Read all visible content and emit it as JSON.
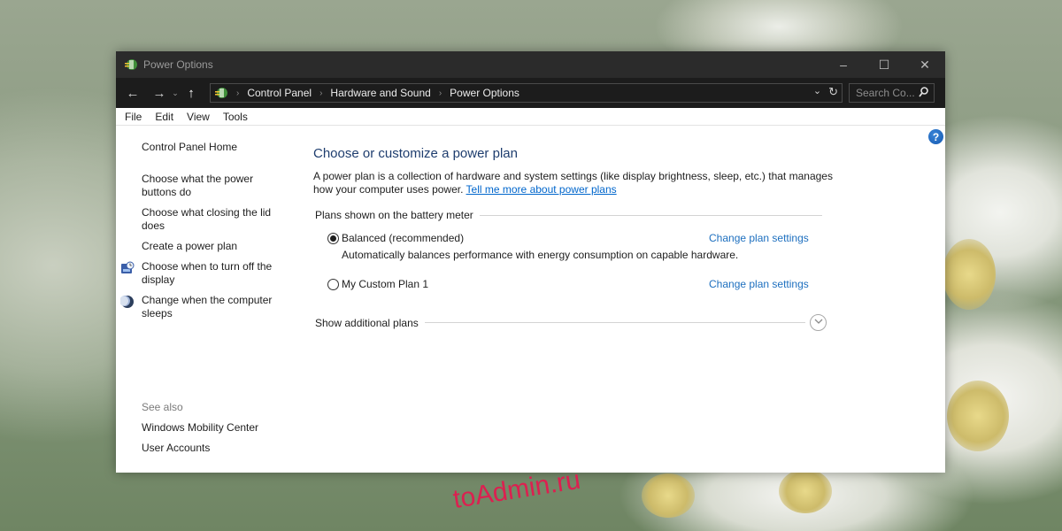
{
  "window": {
    "title": "Power Options",
    "controls": {
      "minimize": "–",
      "maximize": "☐",
      "close": "✕"
    }
  },
  "addressbar": {
    "back_icon": "←",
    "forward_icon": "→",
    "recent_icon": "⌄",
    "up_icon": "↑",
    "breadcrumbs": [
      "Control Panel",
      "Hardware and Sound",
      "Power Options"
    ],
    "separator": "›",
    "dropdown_icon": "⌄",
    "refresh_icon": "↻",
    "search_placeholder": "Search Co...",
    "search_icon": "⚲"
  },
  "menubar": [
    "File",
    "Edit",
    "View",
    "Tools"
  ],
  "sidebar": {
    "home": "Control Panel Home",
    "links": [
      {
        "label": "Choose what the power buttons do",
        "icon": null
      },
      {
        "label": "Choose what closing the lid does",
        "icon": null
      },
      {
        "label": "Create a power plan",
        "icon": null
      },
      {
        "label": "Choose when to turn off the display",
        "icon": "display-clock-icon"
      },
      {
        "label": "Change when the computer sleeps",
        "icon": "moon-sleep-icon"
      }
    ],
    "see_also_label": "See also",
    "see_also": [
      "Windows Mobility Center",
      "User Accounts"
    ]
  },
  "help_icon": "?",
  "main": {
    "title": "Choose or customize a power plan",
    "description": "A power plan is a collection of hardware and system settings (like display brightness, sleep, etc.) that manages how your computer uses power.",
    "learn_more_link": "Tell me more about power plans",
    "group_label": "Plans shown on the battery meter",
    "plans": [
      {
        "name": "Balanced (recommended)",
        "selected": true,
        "description": "Automatically balances performance with energy consumption on capable hardware.",
        "link": "Change plan settings"
      },
      {
        "name": "My Custom Plan 1",
        "selected": false,
        "description": "",
        "link": "Change plan settings"
      }
    ],
    "show_additional": "Show additional plans",
    "expand_icon": "⌄"
  },
  "colors": {
    "title_bar": "#2b2b2b",
    "address_bar": "#1c1c1c",
    "heading": "#1e3d6e",
    "link": "#1d6fbf",
    "help": "#1458b0"
  },
  "watermark": "toAdmin.ru"
}
